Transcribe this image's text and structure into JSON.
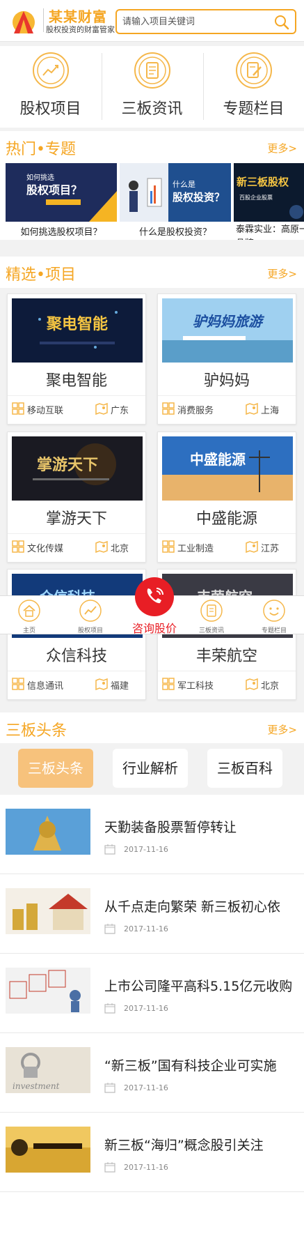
{
  "header": {
    "brand_name": "某某财富",
    "slogan": "股权投资的财富管家",
    "search_placeholder": "请输入项目关键词",
    "colors": {
      "brand": "#f5a623",
      "accent_red": "#e81e25"
    }
  },
  "categories": [
    {
      "label": "股权项目",
      "icon": "chart-trend-icon"
    },
    {
      "label": "三板资讯",
      "icon": "document-icon"
    },
    {
      "label": "专题栏目",
      "icon": "edit-note-icon"
    }
  ],
  "hot_topics": {
    "title": "热门•专题",
    "more": "更多>",
    "items": [
      {
        "caption": "如何挑选股权项目？",
        "img_text_1": "如何挑选",
        "img_text_2": "股权项目？"
      },
      {
        "caption": "什么是股权投资？",
        "img_text_1": "什么是",
        "img_text_2": "股权投资？"
      },
      {
        "caption": "泰霖实业：高原一品牌",
        "img_text_1": "新三板股权",
        "img_text_2": "百股企业股票"
      }
    ]
  },
  "projects": {
    "title": "精选•项目",
    "more": "更多>",
    "items": [
      {
        "name": "聚电智能",
        "banner": "聚电智能",
        "industry": "移动互联",
        "region": "广东"
      },
      {
        "name": "驴妈妈",
        "banner": "驴妈妈旅游",
        "industry": "消费服务",
        "region": "上海"
      },
      {
        "name": "掌游天下",
        "banner": "掌游天下",
        "industry": "文化传媒",
        "region": "北京"
      },
      {
        "name": "中盛能源",
        "banner": "中盛能源",
        "industry": "工业制造",
        "region": "江苏"
      },
      {
        "name": "众信科技",
        "banner": "众信科技",
        "industry": "信息通讯",
        "region": "福建"
      },
      {
        "name": "丰荣航空",
        "banner": "丰荣航空",
        "industry": "军工科技",
        "region": "北京"
      }
    ]
  },
  "bottom_nav": {
    "items": [
      {
        "label": "主页",
        "icon": "home-icon"
      },
      {
        "label": "股权项目",
        "icon": "chart-trend-icon"
      },
      {
        "label": "三板资讯",
        "icon": "document-icon"
      },
      {
        "label": "专题栏目",
        "icon": "smile-icon"
      }
    ],
    "consult_label": "咨询股价"
  },
  "news": {
    "title": "三板头条",
    "more": "更多>",
    "tabs": [
      "三板头条",
      "行业解析",
      "三板百科"
    ],
    "active_tab": 0,
    "items": [
      {
        "title": "天勤装备股票暂停转让",
        "date": "2017-11-16"
      },
      {
        "title": "从千点走向繁荣 新三板初心依",
        "date": "2017-11-16"
      },
      {
        "title": "上市公司隆平高科5.15亿元收购",
        "date": "2017-11-16"
      },
      {
        "title": "“新三板”国有科技企业可实施",
        "date": "2017-11-16"
      },
      {
        "title": "新三板“海归”概念股引关注",
        "date": "2017-11-16"
      }
    ]
  }
}
